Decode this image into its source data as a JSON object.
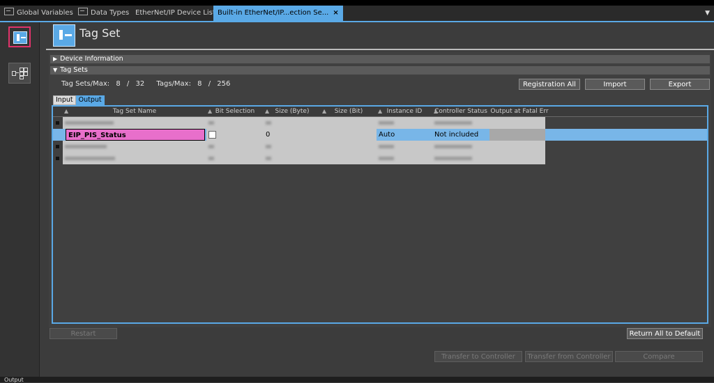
{
  "tabs": [
    {
      "label": "Global Variables"
    },
    {
      "label": "Data Types"
    },
    {
      "label": "EtherNet/IP Device List"
    },
    {
      "label": "Built-in EtherNet/IP...ection Se...",
      "close": "×"
    }
  ],
  "page": {
    "title": "Tag Set"
  },
  "sections": {
    "device_info": {
      "arrow": "▶",
      "label": "Device Information"
    },
    "tag_sets": {
      "arrow": "▼",
      "label": "Tag Sets"
    }
  },
  "counts": {
    "tag_sets_label": "Tag Sets/Max:",
    "tag_sets_value": "8",
    "tag_sets_sep": "/",
    "tag_sets_max": "32",
    "tags_label": "Tags/Max:",
    "tags_value": "8",
    "tags_sep": "/",
    "tags_max": "256"
  },
  "buttons": {
    "registration_all": "Registration All",
    "import": "Import",
    "export": "Export",
    "restart": "Restart",
    "return_all": "Return All to Default",
    "transfer_to": "Transfer to Controller",
    "transfer_from": "Transfer from Controller",
    "compare": "Compare"
  },
  "subtabs": {
    "input": "Input",
    "output": "Output"
  },
  "grid": {
    "columns": [
      {
        "label": "Tag Set Name"
      },
      {
        "label": "Bit Selection"
      },
      {
        "label": "Size (Byte)"
      },
      {
        "label": "Size (Bit)"
      },
      {
        "label": "Instance ID"
      },
      {
        "label": "Controller Status"
      },
      {
        "label": "Output at Fatal Err"
      }
    ],
    "selected_row": {
      "name": "EIP_PIS_Status",
      "size_byte": "0",
      "instance_id": "Auto",
      "controller_status": "Not included"
    }
  },
  "output_panel": {
    "label": "Output"
  },
  "colors": {
    "accent": "#5aa9e6",
    "selection": "#78b6e8",
    "highlight": "#e86fcb",
    "rail_select": "#e0336a"
  }
}
